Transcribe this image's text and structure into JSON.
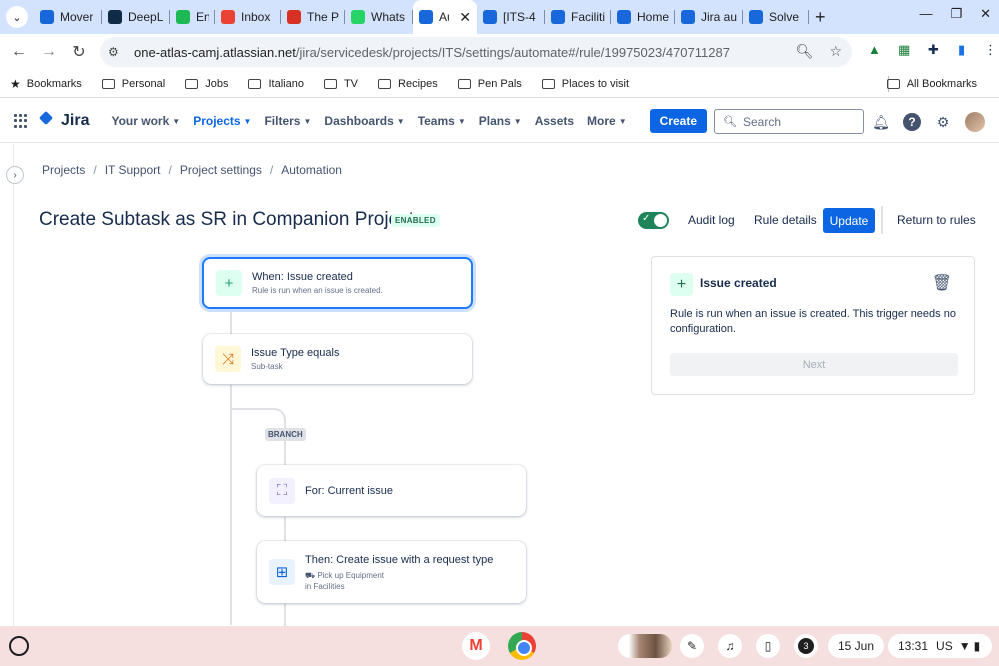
{
  "browser": {
    "tabs": [
      {
        "label": "Mover",
        "color": "#1868db"
      },
      {
        "label": "DeepL",
        "color": "#0f2b46"
      },
      {
        "label": "En",
        "color": "#1db954"
      },
      {
        "label": "Inbox",
        "color": "#ea4335"
      },
      {
        "label": "The Pr",
        "color": "#d93025"
      },
      {
        "label": "Whats",
        "color": "#25d366"
      },
      {
        "label": "Au",
        "color": "#1868db",
        "active": true
      },
      {
        "label": "[ITS-4",
        "color": "#1868db"
      },
      {
        "label": "Faciliti",
        "color": "#1868db"
      },
      {
        "label": "Home",
        "color": "#1868db"
      },
      {
        "label": "Jira au",
        "color": "#1868db"
      },
      {
        "label": "Solve",
        "color": "#1868db"
      }
    ],
    "url": "one-atlas-camj.atlassian.net",
    "url_path": "/jira/servicedesk/projects/ITS/settings/automate#/rule/19975023/470711287"
  },
  "bookmarks": {
    "items": [
      "Bookmarks",
      "Personal",
      "Jobs",
      "Italiano",
      "TV",
      "Recipes",
      "Pen Pals",
      "Places to visit"
    ],
    "all": "All Bookmarks"
  },
  "jira": {
    "product": "Jira",
    "nav": [
      {
        "label": "Your work",
        "caret": true
      },
      {
        "label": "Projects",
        "caret": true,
        "active": true
      },
      {
        "label": "Filters",
        "caret": true
      },
      {
        "label": "Dashboards",
        "caret": true
      },
      {
        "label": "Teams",
        "caret": true
      },
      {
        "label": "Plans",
        "caret": true
      },
      {
        "label": "Assets",
        "caret": false
      },
      {
        "label": "More",
        "caret": true
      }
    ],
    "create_label": "Create",
    "search_placeholder": "Search"
  },
  "page": {
    "breadcrumbs": [
      "Projects",
      "IT Support",
      "Project settings",
      "Automation"
    ],
    "title": "Create Subtask as SR in Companion Project",
    "status": "ENABLED",
    "audit_log": "Audit log",
    "rule_details": "Rule details",
    "update": "Update",
    "return": "Return to rules"
  },
  "rule": {
    "trigger": {
      "title": "When: Issue created",
      "subtitle": "Rule is run when an issue is created."
    },
    "condition": {
      "title": "Issue Type equals",
      "subtitle": "Sub-task"
    },
    "branch_label": "BRANCH",
    "branch": {
      "title": "For: Current issue"
    },
    "action": {
      "title": "Then: Create issue with a request type",
      "subtitle": "Pick up Equipment",
      "subtitle2": "in Facilities"
    }
  },
  "panel": {
    "title": "Issue created",
    "description": "Rule is run when an issue is created. This trigger needs no configuration.",
    "next": "Next"
  },
  "shelf": {
    "notifications": "3",
    "date": "15 Jun",
    "time": "13:31",
    "locale": "US"
  }
}
